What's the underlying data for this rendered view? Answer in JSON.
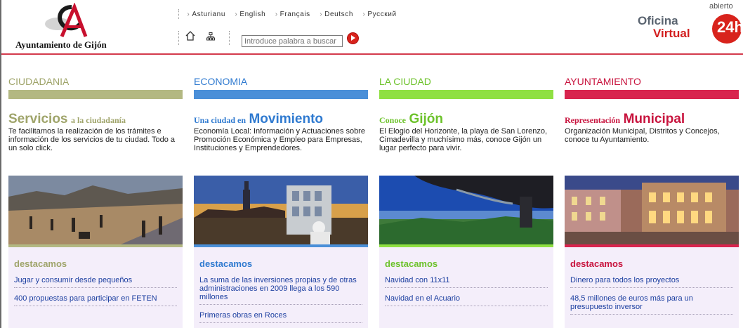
{
  "header": {
    "org_name": "Ayuntamiento de Gijón",
    "languages": [
      "Asturianu",
      "English",
      "Français",
      "Deutsch",
      "Русский"
    ],
    "search": {
      "placeholder": "Introduce palabra a buscar"
    },
    "oficina": {
      "line1": "Oficina",
      "line2": "Virtual",
      "abierto": "abierto",
      "hours": "24h"
    }
  },
  "columns": [
    {
      "title": "CIUDADANIA",
      "color": "#b3b882",
      "head_big": "Servicios",
      "head_small": "a la ciudadanía",
      "big_first": true,
      "desc": "Te facilitamos la realización de los trámites e información de los servicios de tu ciudad. Todo a un solo click.",
      "dest_label": "destacamos",
      "items": [
        "Jugar y consumir desde pequeños",
        "400 propuestas para participar en FETEN"
      ]
    },
    {
      "title": "ECONOMIA",
      "color": "#4a8fd8",
      "head_small": "Una ciudad en",
      "head_big": "Movimiento",
      "big_first": false,
      "desc": "Economía Local: Información y Actuaciones sobre Promoción Económica y Empleo para Empresas, Instituciones y Emprendedores.",
      "dest_label": "destacamos",
      "items": [
        "La suma de las inversiones propias y de otras administraciones en 2009 llega a los 590 millones",
        "Primeras obras en Roces"
      ]
    },
    {
      "title": "LA CIUDAD",
      "color": "#8fe042",
      "head_small": "Conoce",
      "head_big": "Gijón",
      "big_first": false,
      "desc": "El Elogio del Horizonte, la playa de San Lorenzo, Cimadevilla y muchísimo más, conoce Gijón un lugar perfecto para vivir.",
      "dest_label": "destacamos",
      "items": [
        "Navidad con 11x11",
        "Navidad en el Acuario"
      ]
    },
    {
      "title": "AYUNTAMIENTO",
      "color": "#d8244e",
      "head_small": "Representación",
      "head_big": "Municipal",
      "big_first": false,
      "desc": "Organización Municipal, Distritos y Concejos, conoce tu Ayuntamiento.",
      "dest_label": "destacamos",
      "items": [
        "Dinero para todos los proyectos",
        "48,5 millones de euros más para un presupuesto inversor"
      ]
    }
  ]
}
